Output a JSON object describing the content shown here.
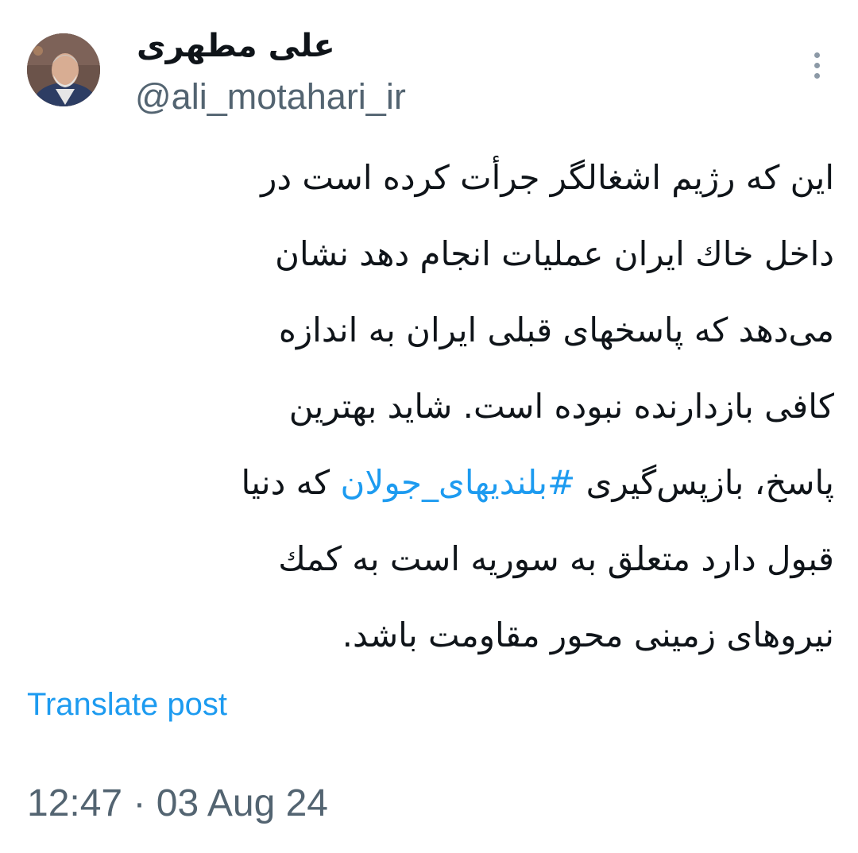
{
  "author": {
    "display_name": "علی مطهری",
    "handle": "@ali_motahari_ir",
    "avatar_icon": "profile-photo"
  },
  "menu": {
    "icon": "more-vertical-icon"
  },
  "tweet": {
    "lines": [
      "این که رژیم اشغالگر جرأت کرده است در",
      "داخل خاك ایران عملیات انجام دهد نشان",
      "می‌دهد که پاسخهای قبلی ایران به اندازه",
      "کافی بازدارنده نبوده است. شاید بهترین",
      "",
      "قبول دارد متعلق به سوریه است به کمك",
      "نیروهای زمینی محور مقاومت باشد."
    ],
    "line5": {
      "before": "پاسخ، بازپس‌گیری ",
      "hashtag": "#بلندیهای_جولان",
      "after": " که دنیا"
    },
    "link_color": "#1d9bf0"
  },
  "translate_label": "Translate post",
  "timestamp": "12:47 · 03 Aug 24"
}
